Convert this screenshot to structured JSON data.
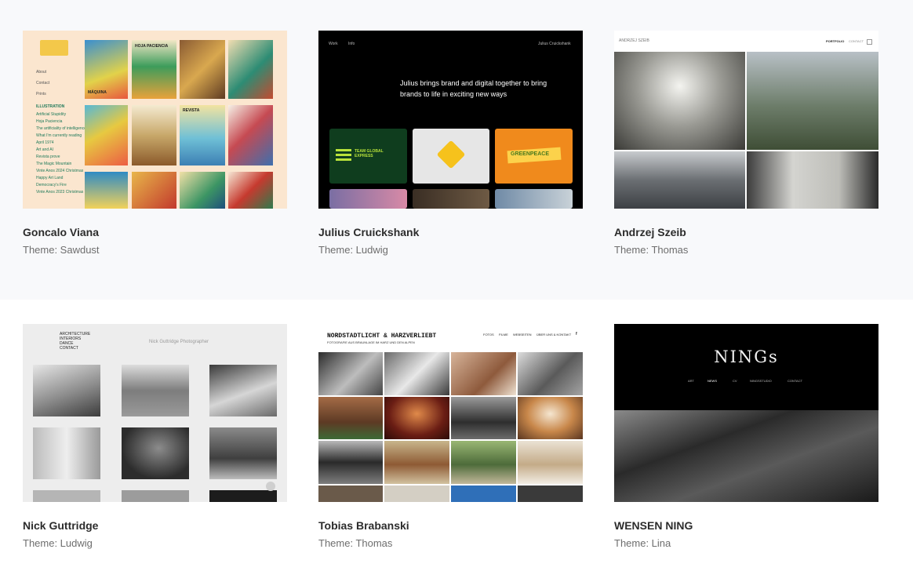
{
  "cards": [
    {
      "title": "Goncalo Viana",
      "theme": "Theme: Sawdust",
      "preview": {
        "nav": [
          "About",
          "Contact",
          "Prints"
        ],
        "section": "ILLUSTRATION",
        "items": [
          "Artificial Stupidity",
          "Hoja Paciencia",
          "The artificiality of intelligence",
          "What I'm currently reading",
          "April 1974",
          "Art and AI",
          "Revista prove",
          "The Magic Mountain",
          "Vinte Anos 2024 Christmas",
          "Happy Art Land",
          "Democracy's Fire",
          "Vinte Anos 2023 Christmas"
        ],
        "tiles": [
          "MÁQUINA",
          "HOJA PACIENCIA",
          "REVISTA"
        ]
      },
      "colors": {
        "bg": "#fbe6cf",
        "accent": "#1f7a5a"
      }
    },
    {
      "title": "Julius Cruickshank",
      "theme": "Theme: Ludwig",
      "preview": {
        "nav": [
          "Work",
          "Info"
        ],
        "name": "Julius Cruickshank",
        "headline": "Julius brings brand and digital together to bring brands to life in exciting new ways",
        "tiles": [
          "TEAM GLOBAL EXPRESS",
          "",
          "GREENPEACE"
        ]
      },
      "colors": {
        "bg": "#000000",
        "green": "#0f3d1e",
        "orange": "#f08a1c"
      }
    },
    {
      "title": "Andrzej Szeib",
      "theme": "Theme: Thomas",
      "preview": {
        "name": "ANDRZEJ SZEIB",
        "nav": [
          "PORTFOLIO",
          "CONTACT"
        ]
      },
      "colors": {
        "bg": "#ffffff"
      }
    },
    {
      "title": "Nick Guttridge",
      "theme": "Theme: Ludwig",
      "preview": {
        "nav": [
          "ARCHITECTURE",
          "INTERIORS",
          "DANCE",
          "CONTACT"
        ],
        "name": "Nick Guttridge Photographer"
      },
      "colors": {
        "bg": "#ededed"
      }
    },
    {
      "title": "Tobias Brabanski",
      "theme": "Theme: Thomas",
      "preview": {
        "name": "NORDSTADTLICHT & HARZVERLIEBT",
        "subtitle": "FOTOGRAFIE AUS BRAUNLAGE IM HARZ UND DEN ALPEN",
        "nav": [
          "FOTOS",
          "FILME",
          "WEBSEITEN",
          "ÜBER UNS & KONTAKT",
          "f"
        ]
      },
      "colors": {
        "bg": "#ffffff"
      }
    },
    {
      "title": "WENSEN NING",
      "theme": "Theme: Lina",
      "preview": {
        "name": "NINGs",
        "nav": [
          "ART",
          "NEWS",
          "CV",
          "NINGSSTUDIO",
          "CONTACT"
        ]
      },
      "colors": {
        "bg": "#000000"
      }
    }
  ]
}
